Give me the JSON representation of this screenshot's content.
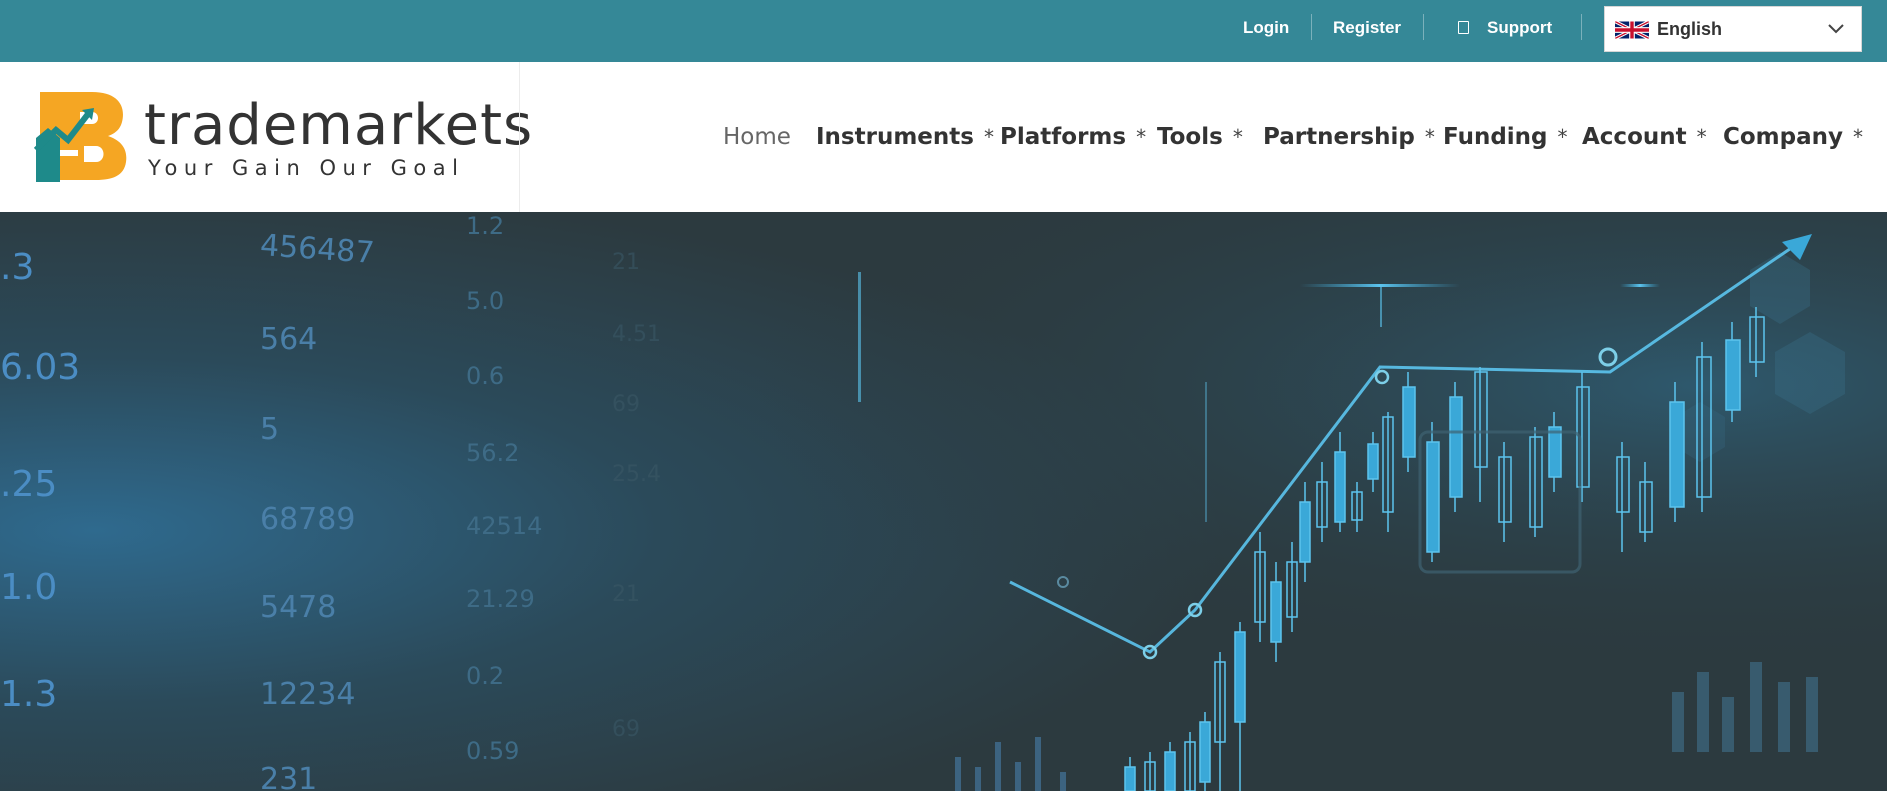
{
  "topbar": {
    "login": "Login",
    "register": "Register",
    "support": "Support",
    "language": {
      "selected": "English",
      "flag_icon": "uk-flag-icon"
    }
  },
  "logo": {
    "brand": "trademarkets",
    "tagline": "Your Gain Our Goal"
  },
  "nav": {
    "items": [
      {
        "label": "Home",
        "active": true,
        "dropdown": false
      },
      {
        "label": "Instruments",
        "dropdown": true
      },
      {
        "label": "Platforms",
        "dropdown": true
      },
      {
        "label": "Tools",
        "dropdown": true
      },
      {
        "label": "Partnership",
        "dropdown": true
      },
      {
        "label": "Funding",
        "dropdown": true
      },
      {
        "label": "Account",
        "dropdown": true
      },
      {
        "label": "Company",
        "dropdown": true
      }
    ],
    "dropdown_marker": "*"
  },
  "hero": {
    "column1": [
      ".3",
      "6.03",
      ".25",
      "1.0",
      "1.3"
    ],
    "column2": [
      "456487",
      "564",
      "5",
      "68789",
      "5478",
      "12234",
      "231"
    ],
    "column3": [
      "1.2",
      "5.0",
      "0.6",
      "56.2",
      "42514",
      "21.29",
      "0.2",
      "0.59"
    ],
    "column4": [
      "21",
      "4.51",
      "69",
      "25.4",
      "21",
      "69"
    ]
  },
  "colors": {
    "topbar": "#358897",
    "accent_logo": "#f5a623",
    "accent_logo_teal": "#1e8a8a",
    "chart_line": "#5cc4ee"
  }
}
